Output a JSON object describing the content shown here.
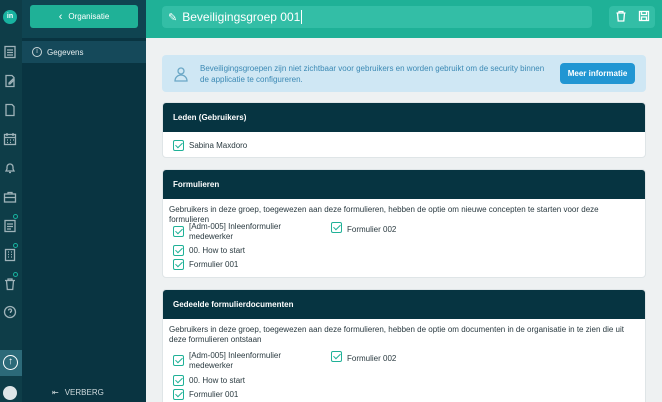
{
  "header": {
    "title": "Beveiligingsgroep 001"
  },
  "sidebar": {
    "org_button": "Organisatie",
    "items": [
      {
        "label": "Gegevens"
      }
    ],
    "hide_label": "VERBERG"
  },
  "banner": {
    "text": "Beveiligingsgroepen zijn niet zichtbaar voor gebruikers en worden gebruikt om de security binnen de applicatie te configureren.",
    "button": "Meer informatie"
  },
  "sections": {
    "members": {
      "title": "Leden (Gebruikers)",
      "items": [
        "Sabina Maxdoro"
      ]
    },
    "forms": {
      "title": "Formulieren",
      "description": "Gebruikers in deze groep, toegewezen aan deze formulieren, hebben de optie om nieuwe concepten te starten voor deze formulieren",
      "items": [
        "[Adm-005] Inleenformulier medewerker",
        "Formulier 002",
        "00. How to start",
        "Formulier 001"
      ]
    },
    "shared": {
      "title": "Gedeelde formulierdocumenten",
      "description": "Gebruikers in deze groep, toegewezen aan deze formulieren, hebben de optie om documenten in de organisatie in te zien die uit deze formulieren ontstaan",
      "items": [
        "[Adm-005] Inleenformulier medewerker",
        "Formulier 002",
        "00. How to start",
        "Formulier 001"
      ]
    }
  },
  "icons": {
    "rail": [
      "logo-icon",
      "list-icon",
      "document-edit-icon",
      "document-icon",
      "calendar-icon",
      "bell-icon",
      "briefcase-icon",
      "list-alt-icon",
      "building-icon",
      "trash-icon",
      "help-icon"
    ],
    "header": [
      "pencil-icon",
      "trash-icon",
      "save-icon"
    ]
  },
  "colors": {
    "accent": "#1fb197",
    "sidebar": "#093441",
    "section_header": "#063441",
    "info_banner": "#cfe7f4",
    "info_button": "#2196d3"
  }
}
